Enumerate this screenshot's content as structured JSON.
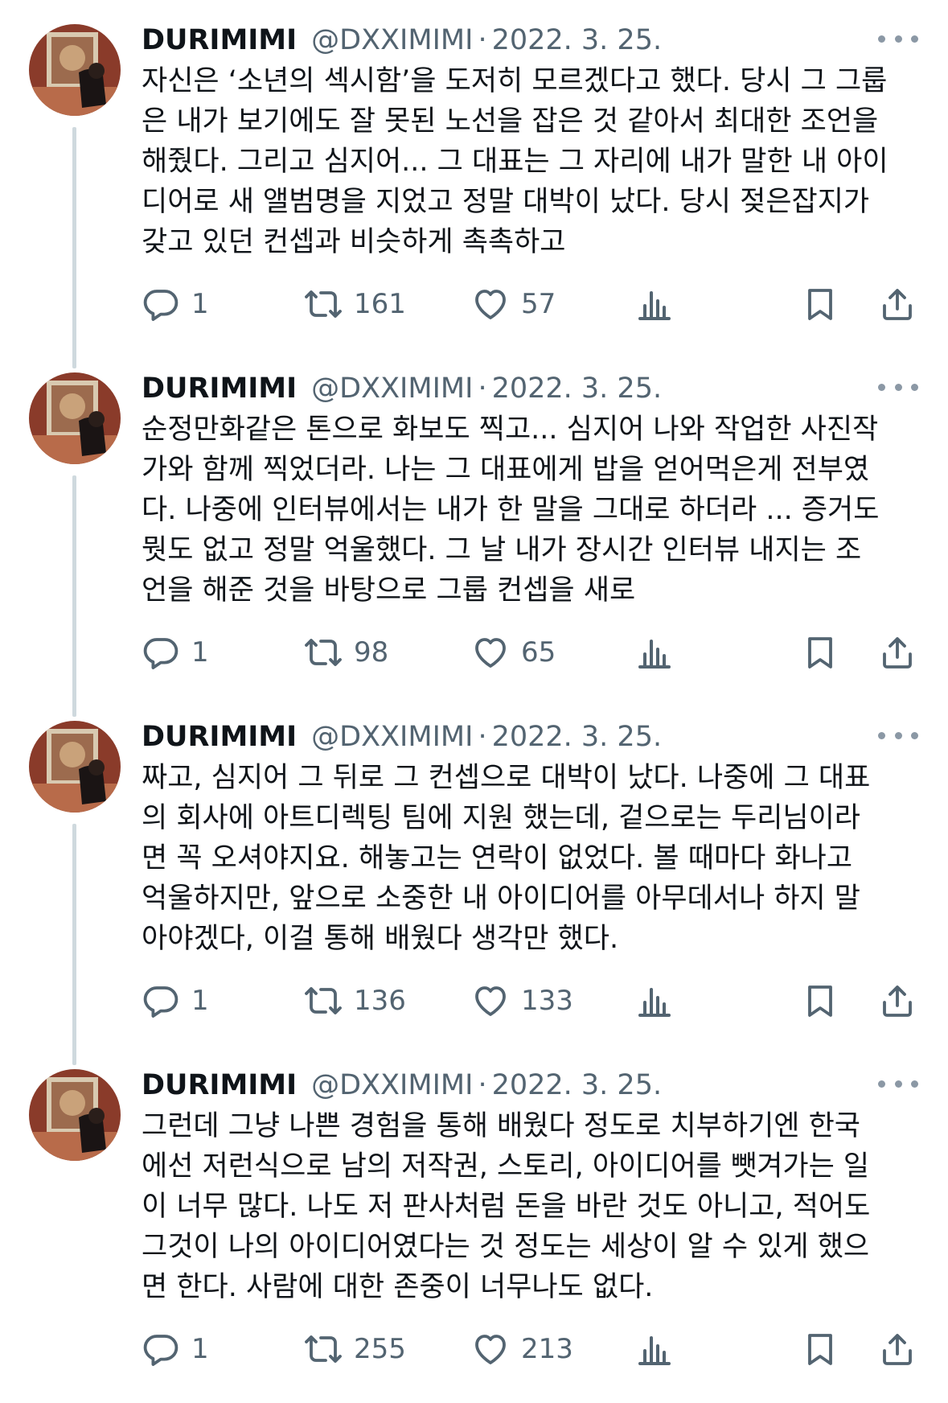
{
  "tweets": [
    {
      "name": "DURIMIMI",
      "handle": "@DXXIMIMI",
      "separator": "·",
      "date": "2022. 3. 25.",
      "lines": [
        "자신은 ‘소년의 섹시함’을 도저히 모르겠다고 했다. 당시 그 그룹",
        "은 내가 보기에도 잘 못된 노선을 잡은 것 같아서 최대한 조언을",
        "해줬다. 그리고 심지어... 그 대표는 그 자리에 내가 말한 내 아이",
        "디어로 새 앨범명을 지었고 정말 대박이 났다. 당시 젖은잡지가",
        "갖고 있던 컨셉과 비슷하게 촉촉하고"
      ],
      "replies": "1",
      "retweets": "161",
      "likes": "57"
    },
    {
      "name": "DURIMIMI",
      "handle": "@DXXIMIMI",
      "separator": "·",
      "date": "2022. 3. 25.",
      "lines": [
        "순정만화같은 톤으로 화보도 찍고... 심지어 나와 작업한 사진작",
        "가와 함께 찍었더라. 나는 그 대표에게 밥을 얻어먹은게 전부였",
        "다. 나중에 인터뷰에서는 내가 한 말을 그대로 하더라 ... 증거도",
        "뭣도 없고 정말 억울했다. 그 날 내가 장시간 인터뷰 내지는 조",
        "언을 해준 것을 바탕으로 그룹 컨셉을 새로"
      ],
      "replies": "1",
      "retweets": "98",
      "likes": "65"
    },
    {
      "name": "DURIMIMI",
      "handle": "@DXXIMIMI",
      "separator": "·",
      "date": "2022. 3. 25.",
      "lines": [
        "짜고, 심지어 그 뒤로 그 컨셉으로 대박이 났다. 나중에 그 대표",
        "의 회사에 아트디렉팅 팀에 지원 했는데, 겉으로는 두리님이라",
        "면 꼭 오셔야지요. 해놓고는 연락이 없었다. 볼 때마다 화나고",
        "억울하지만, 앞으로 소중한 내 아이디어를 아무데서나 하지 말",
        "아야겠다, 이걸 통해 배웠다 생각만 했다."
      ],
      "replies": "1",
      "retweets": "136",
      "likes": "133"
    },
    {
      "name": "DURIMIMI",
      "handle": "@DXXIMIMI",
      "separator": "·",
      "date": "2022. 3. 25.",
      "lines": [
        "그런데 그냥 나쁜 경험을 통해 배웠다 정도로 치부하기엔 한국",
        "에선 저런식으로 남의 저작권, 스토리, 아이디어를 뺏겨가는 일",
        "이 너무 많다. 나도 저 판사처럼 돈을 바란 것도 아니고, 적어도",
        "그것이 나의 아이디어였다는 것 정도는 세상이 알 수 있게 했으",
        "면 한다. 사람에 대한 존중이 너무나도 없다."
      ],
      "replies": "1",
      "retweets": "255",
      "likes": "213"
    }
  ],
  "icons": {
    "avatar": "profile-photo",
    "more": "more-horizontal-icon",
    "reply": "reply-icon",
    "retweet": "retweet-icon",
    "like": "heart-icon",
    "views": "views-icon",
    "bookmark": "bookmark-icon",
    "share": "share-icon"
  },
  "colors": {
    "text": "#0f1419",
    "secondary": "#536471",
    "thread_line": "#cfd9de"
  }
}
